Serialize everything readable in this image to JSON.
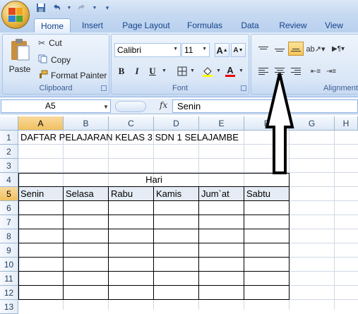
{
  "quick_access": {
    "icons": [
      "save-icon",
      "undo-icon",
      "redo-icon",
      "customize-icon"
    ]
  },
  "tabs": [
    {
      "label": "Home",
      "active": true
    },
    {
      "label": "Insert"
    },
    {
      "label": "Page Layout"
    },
    {
      "label": "Formulas"
    },
    {
      "label": "Data"
    },
    {
      "label": "Review"
    },
    {
      "label": "View"
    }
  ],
  "clipboard": {
    "paste": "Paste",
    "cut": "Cut",
    "copy": "Copy",
    "format_painter": "Format Painter",
    "label": "Clipboard"
  },
  "font": {
    "name": "Calibri",
    "size": "11",
    "bold": "B",
    "italic": "I",
    "underline": "U",
    "font_color_letter": "A",
    "grow": "A",
    "shrink": "A",
    "label": "Font"
  },
  "alignment": {
    "label": "Alignment"
  },
  "formula_bar": {
    "name_box": "A5",
    "fx": "fx",
    "value": "Senin"
  },
  "grid": {
    "columns": [
      "A",
      "B",
      "C",
      "D",
      "E",
      "F",
      "G",
      "H"
    ],
    "selected_column": "A",
    "rows": [
      "1",
      "2",
      "3",
      "4",
      "5",
      "6",
      "7",
      "8",
      "9",
      "10",
      "11",
      "12",
      "13"
    ],
    "selected_row": "5",
    "cells": {
      "A1": "DAFTAR PELAJARAN KELAS 3 SDN 1 SELAJAMBE",
      "hari": "Hari",
      "days": [
        "Senin",
        "Selasa",
        "Rabu",
        "Kamis",
        "Jum`at",
        "Sabtu"
      ]
    }
  },
  "colors": {
    "accent": "#15428b",
    "ribbon": "#dae7f7",
    "selected_header": "#f1c15f"
  }
}
